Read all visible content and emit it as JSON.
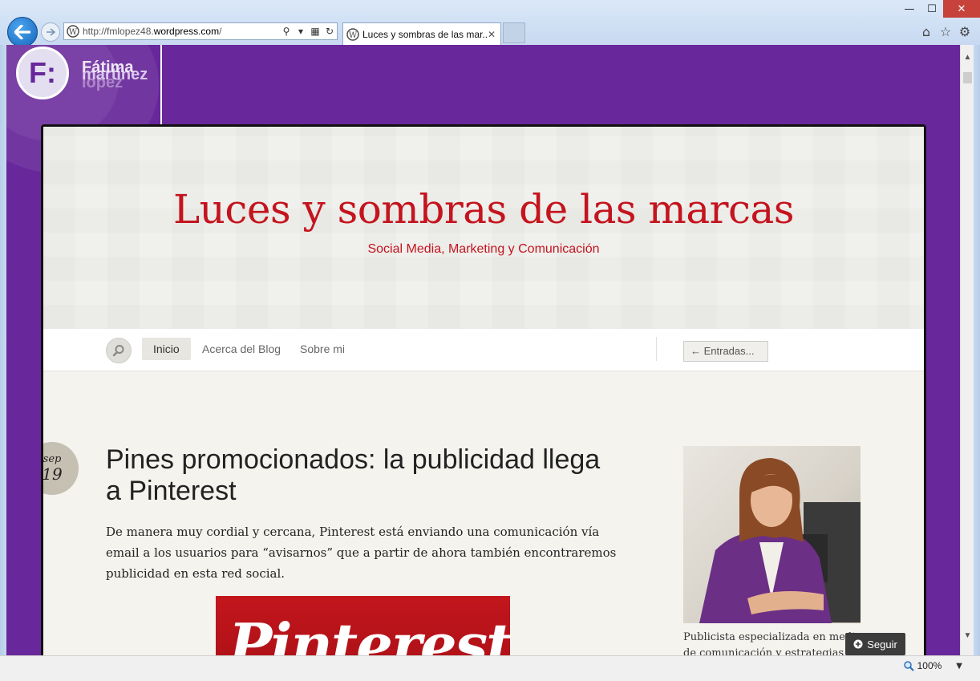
{
  "browser": {
    "url_prefix": "http://fmlopez48.",
    "url_domain": "wordpress.com",
    "url_suffix": "/",
    "tab_title": "Luces y sombras de las mar...",
    "zoom": "100%",
    "window_controls": {
      "minimize": "—",
      "maximize": "☐",
      "close": "✕"
    }
  },
  "brand": {
    "logo_letter": "F:",
    "name_line1": "Fátima",
    "name_line2": "martínez",
    "name_line3": "lopez",
    "accent_color": "#68279a"
  },
  "blog": {
    "title": "Luces y sombras de las marcas",
    "description": "Social Media, Marketing y Comunicación",
    "title_color": "#c4141d"
  },
  "nav": {
    "items": [
      "Inicio",
      "Acerca del Blog",
      "Sobre mi"
    ],
    "entries_button": "← Entradas..."
  },
  "post": {
    "month": "sep",
    "day": "19",
    "title": "Pines promocionados: la publicidad llega a Pinterest",
    "excerpt": "De manera muy cordial y cercana, Pinterest está enviando una comunicación vía email a los usuarios para “avisarnos” que a partir de ahora también encontraremos publicidad en esta red social.",
    "image_text": "Pinterest"
  },
  "sidebar": {
    "profile_desc": "Publicista especializada en medios de comunicación y estrategias de"
  },
  "follow": {
    "label": "Seguir"
  }
}
